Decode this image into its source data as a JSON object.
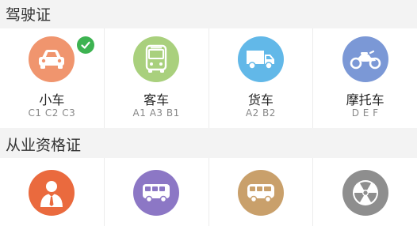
{
  "license_section": {
    "title": "驾驶证",
    "items": [
      {
        "name": "小车",
        "codes": "C1 C2 C3",
        "color": "#f0956e",
        "icon": "car-icon",
        "selected": true
      },
      {
        "name": "客车",
        "codes": "A1 A3 B1",
        "color": "#a9d07d",
        "icon": "bus-icon",
        "selected": false
      },
      {
        "name": "货车",
        "codes": "A2 B2",
        "color": "#62b8e8",
        "icon": "truck-icon",
        "selected": false
      },
      {
        "name": "摩托车",
        "codes": "D E F",
        "color": "#7b98d6",
        "icon": "motorcycle-icon",
        "selected": false
      }
    ]
  },
  "qualification_section": {
    "title": "从业资格证",
    "items": [
      {
        "color": "#ea6a3e",
        "icon": "instructor-icon"
      },
      {
        "color": "#8c77c5",
        "icon": "passenger-bus-icon"
      },
      {
        "color": "#c9a06b",
        "icon": "freight-bus-icon"
      },
      {
        "color": "#8e8e8e",
        "icon": "hazardous-icon"
      }
    ]
  },
  "colors": {
    "check": "#3db351",
    "background": "#f3f3f3"
  }
}
